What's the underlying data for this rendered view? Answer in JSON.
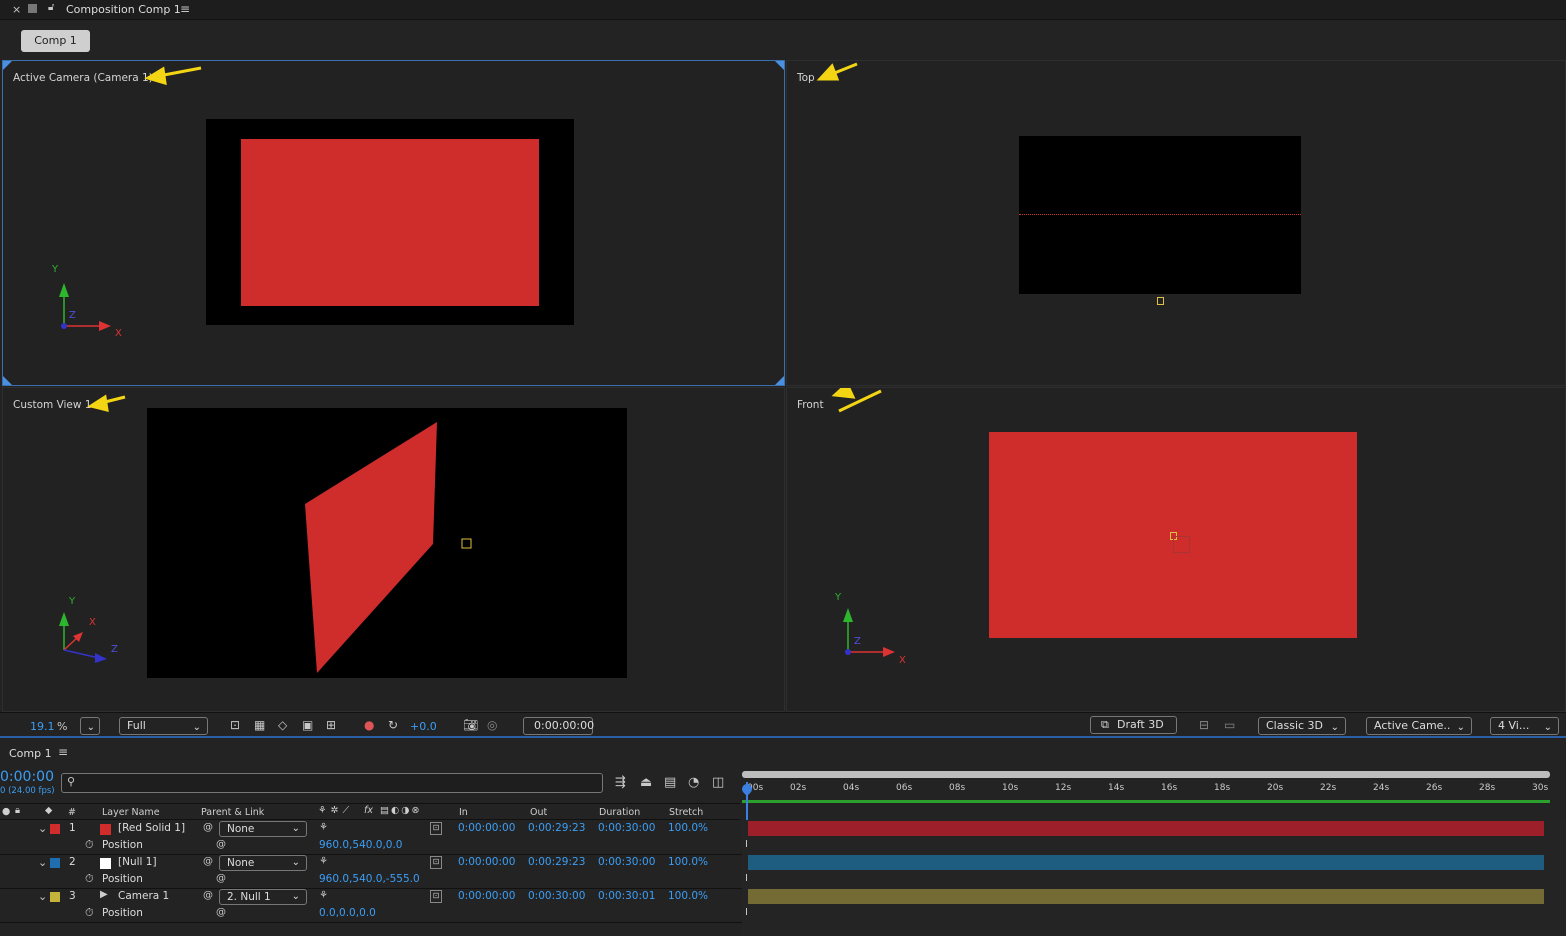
{
  "window": {
    "title": "Composition Comp 1",
    "menu_icon": "hamburger-icon"
  },
  "tab": {
    "label": "Comp 1"
  },
  "views": {
    "active_camera": "Active Camera (Camera 1)",
    "top": "Top",
    "custom": "Custom View 1",
    "front": "Front"
  },
  "axes": {
    "x": "X",
    "y": "Y",
    "z": "Z"
  },
  "viewer_footer": {
    "zoom": "19.1",
    "zoom_unit": "%",
    "resolution": "Full",
    "exposure": "+0.0",
    "timecode": "0:00:00:00",
    "renderer": "Draft 3D",
    "renderer_type": "Classic 3D",
    "camera": "Active Came..",
    "views_layout": "4 Vi..."
  },
  "timeline": {
    "comp_name": "Comp 1",
    "current_time": "0:00:00",
    "fps": "0 (24.00 fps)",
    "columns": {
      "layer_name": "Layer Name",
      "parent": "Parent & Link",
      "in": "In",
      "out": "Out",
      "duration": "Duration",
      "stretch": "Stretch",
      "num": "#"
    },
    "ruler": [
      "00s",
      "02s",
      "04s",
      "06s",
      "08s",
      "10s",
      "12s",
      "14s",
      "16s",
      "18s",
      "20s",
      "22s",
      "24s",
      "26s",
      "28s",
      "30s"
    ],
    "layers": [
      {
        "num": "1",
        "name": "[Red Solid 1]",
        "label_color": "#d12c2c",
        "parent": "None",
        "in": "0:00:00:00",
        "out": "0:00:29:23",
        "duration": "0:00:30:00",
        "stretch": "100.0%",
        "prop": "Position",
        "value": "960.0,540.0,0.0",
        "bar_color": "#9c1f2a"
      },
      {
        "num": "2",
        "name": "[Null 1]",
        "label_color": "#1f6fb0",
        "parent": "None",
        "in": "0:00:00:00",
        "out": "0:00:29:23",
        "duration": "0:00:30:00",
        "stretch": "100.0%",
        "prop": "Position",
        "value": "960.0,540.0,-555.0",
        "bar_color": "#1f5d80"
      },
      {
        "num": "3",
        "name": "Camera 1",
        "label_color": "#c4b43a",
        "parent": "2. Null 1",
        "in": "0:00:00:00",
        "out": "0:00:30:00",
        "duration": "0:00:30:01",
        "stretch": "100.0%",
        "prop": "Position",
        "value": "0.0,0.0,0.0",
        "bar_color": "#736b33"
      }
    ]
  }
}
